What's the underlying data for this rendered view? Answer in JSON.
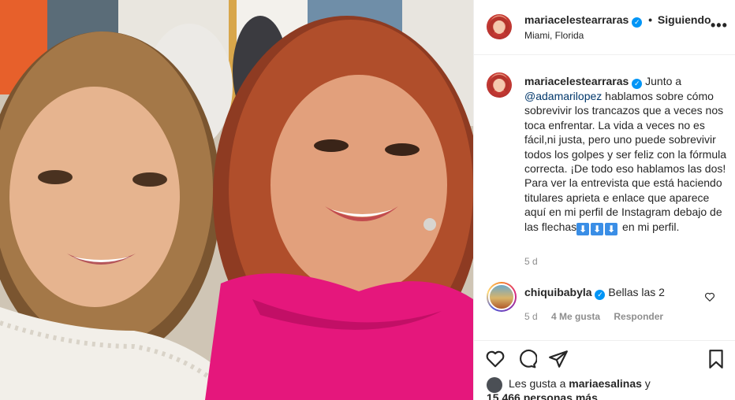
{
  "post": {
    "username": "mariacelestearraras",
    "follow_status": "Siguiendo",
    "location": "Miami, Florida",
    "more_icon": "more-horizontal-icon"
  },
  "caption": {
    "username": "mariacelestearraras",
    "lead": "Junto a",
    "mention": "@adamarilopez",
    "body": "hablamos sobre cómo sobrevivir los trancazos que a veces nos toca enfrentar. La vida a veces no es fácil,ni justa, pero uno puede sobrevivir todos los golpes y ser feliz con la fórmula correcta. ¡De todo eso hablamos las dos! Para ver la entrevista que está haciendo titulares aprieta e enlace que aparece aquí en mi perfil de Instagram debajo de las flechas",
    "arrows": [
      "⬇",
      "⬇",
      "⬇"
    ],
    "tail": "en mi perfil.",
    "time": "5 d"
  },
  "comment": {
    "username": "chiquibabyla",
    "text": "Bellas las 2",
    "time": "5 d",
    "likes": "4 Me gusta",
    "reply": "Responder"
  },
  "actions": {
    "like_icon": "heart-icon",
    "comment_icon": "comment-icon",
    "share_icon": "share-icon",
    "save_icon": "bookmark-icon"
  },
  "likes": {
    "prefix": "Les gusta a",
    "user": "mariaesalinas",
    "and": "y",
    "count": "15.466 personas más"
  },
  "colors": {
    "verified": "#0095f6",
    "link": "#00376b",
    "muted": "#8e8e8e",
    "border": "#efefef",
    "dress": "#e5177c"
  }
}
